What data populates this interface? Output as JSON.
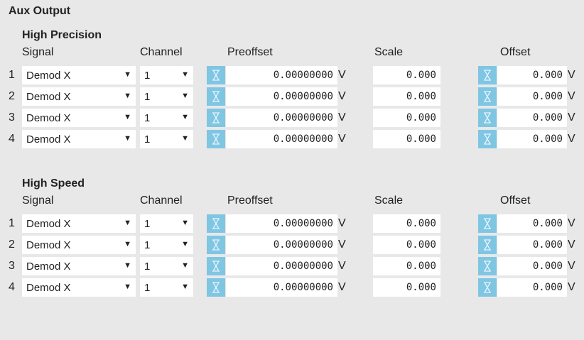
{
  "title": "Aux Output",
  "headers": {
    "signal": "Signal",
    "channel": "Channel",
    "preoffset": "Preoffset",
    "scale": "Scale",
    "offset": "Offset"
  },
  "sections": [
    {
      "title": "High Precision",
      "rows": [
        {
          "index": "1",
          "signal": "Demod X",
          "channel": "1",
          "preoffset": "0.00000000",
          "preoffset_unit": "V",
          "scale": "0.000",
          "offset": "0.000",
          "offset_unit": "V"
        },
        {
          "index": "2",
          "signal": "Demod X",
          "channel": "1",
          "preoffset": "0.00000000",
          "preoffset_unit": "V",
          "scale": "0.000",
          "offset": "0.000",
          "offset_unit": "V"
        },
        {
          "index": "3",
          "signal": "Demod X",
          "channel": "1",
          "preoffset": "0.00000000",
          "preoffset_unit": "V",
          "scale": "0.000",
          "offset": "0.000",
          "offset_unit": "V"
        },
        {
          "index": "4",
          "signal": "Demod X",
          "channel": "1",
          "preoffset": "0.00000000",
          "preoffset_unit": "V",
          "scale": "0.000",
          "offset": "0.000",
          "offset_unit": "V"
        }
      ]
    },
    {
      "title": "High Speed",
      "rows": [
        {
          "index": "1",
          "signal": "Demod X",
          "channel": "1",
          "preoffset": "0.00000000",
          "preoffset_unit": "V",
          "scale": "0.000",
          "offset": "0.000",
          "offset_unit": "V"
        },
        {
          "index": "2",
          "signal": "Demod X",
          "channel": "1",
          "preoffset": "0.00000000",
          "preoffset_unit": "V",
          "scale": "0.000",
          "offset": "0.000",
          "offset_unit": "V"
        },
        {
          "index": "3",
          "signal": "Demod X",
          "channel": "1",
          "preoffset": "0.00000000",
          "preoffset_unit": "V",
          "scale": "0.000",
          "offset": "0.000",
          "offset_unit": "V"
        },
        {
          "index": "4",
          "signal": "Demod X",
          "channel": "1",
          "preoffset": "0.00000000",
          "preoffset_unit": "V",
          "scale": "0.000",
          "offset": "0.000",
          "offset_unit": "V"
        }
      ]
    }
  ],
  "icons": {
    "dropdown_arrow": "▼",
    "auto_button": "hourglass-icon"
  },
  "colors": {
    "background": "#e8e8e8",
    "button": "#7fc6e3",
    "field": "#ffffff"
  }
}
